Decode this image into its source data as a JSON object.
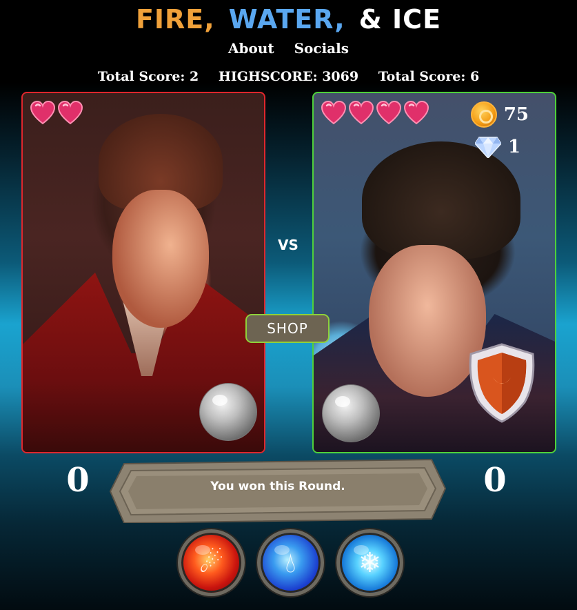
{
  "header": {
    "title_fire": "FIRE,",
    "title_water": "WATER,",
    "title_ice": "& ICE",
    "nav": {
      "about": "About",
      "socials": "Socials"
    }
  },
  "scores": {
    "left_total": "Total Score: 2",
    "highscore": "HIGHSCORE: 3069",
    "right_total": "Total Score: 6"
  },
  "player_left": {
    "hearts": 2,
    "round_score": "0",
    "border_color": "#e0262c"
  },
  "player_right": {
    "hearts": 4,
    "coins": "75",
    "gems": "1",
    "round_score": "0",
    "border_color": "#4fd13a"
  },
  "vs_label": "VS",
  "shop_label": "SHOP",
  "round_message": "You won this Round.",
  "elements": [
    {
      "name": "fire",
      "icon": "fire-element-icon"
    },
    {
      "name": "water",
      "icon": "water-element-icon"
    },
    {
      "name": "ice",
      "icon": "ice-element-icon"
    }
  ]
}
